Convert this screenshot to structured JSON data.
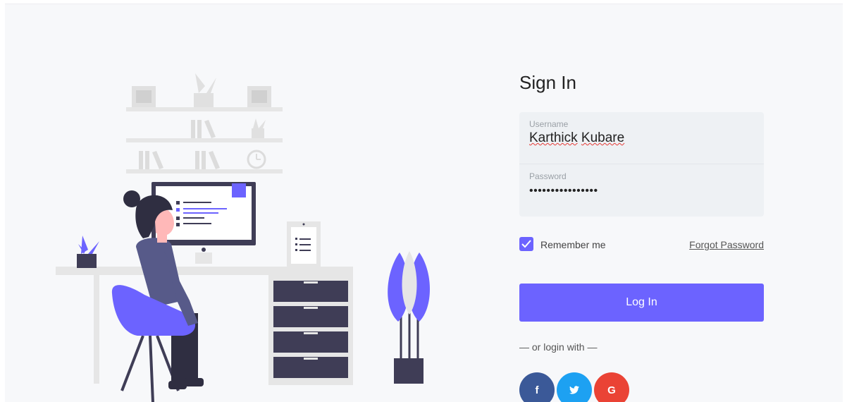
{
  "form": {
    "title": "Sign In",
    "username_label": "Username",
    "username_first": "Karthick",
    "username_last": "Kubare",
    "password_label": "Password",
    "password_value": "••••••••••••••••",
    "remember_label": "Remember me",
    "remember_checked": true,
    "forgot_label": "Forgot Password",
    "login_label": "Log In",
    "or_label": "— or login with —"
  },
  "social": [
    {
      "name": "facebook-icon",
      "glyph": "f",
      "color": "#3b5998"
    },
    {
      "name": "twitter-icon",
      "glyph": "•",
      "color": "#1da1f2"
    },
    {
      "name": "google-icon",
      "glyph": "G",
      "color": "#ea4335"
    }
  ],
  "colors": {
    "accent": "#6c63ff",
    "background": "#f7f8fa",
    "field_bg": "#eef1f4"
  }
}
